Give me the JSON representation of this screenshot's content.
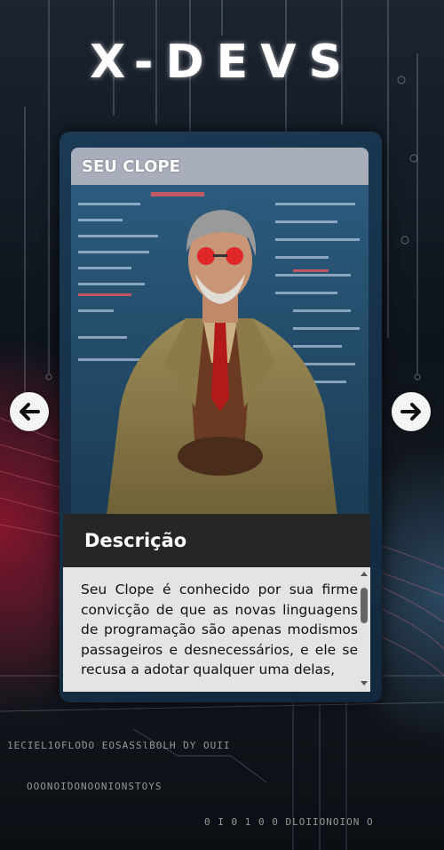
{
  "page": {
    "title": "X-DEVS"
  },
  "card": {
    "name": "SEU CLOPE",
    "description_heading": "Descrição",
    "description": "Seu Clope é conhecido por sua firme convicção de que as novas linguagens de programação são apenas modismos passageiros e desnecessários, e ele se recusa a adotar qualquer uma delas,",
    "description_scroll_fraction": 0.15
  },
  "navigation": {
    "prev_icon": "arrow-left-icon",
    "next_icon": "arrow-right-icon"
  },
  "colors": {
    "title": "#ffffff",
    "description_header_bg": "#262626",
    "description_body_bg": "#e4e4e4",
    "nav_button_bg": "#f4f4f4",
    "background_red": "#aa1432"
  }
}
